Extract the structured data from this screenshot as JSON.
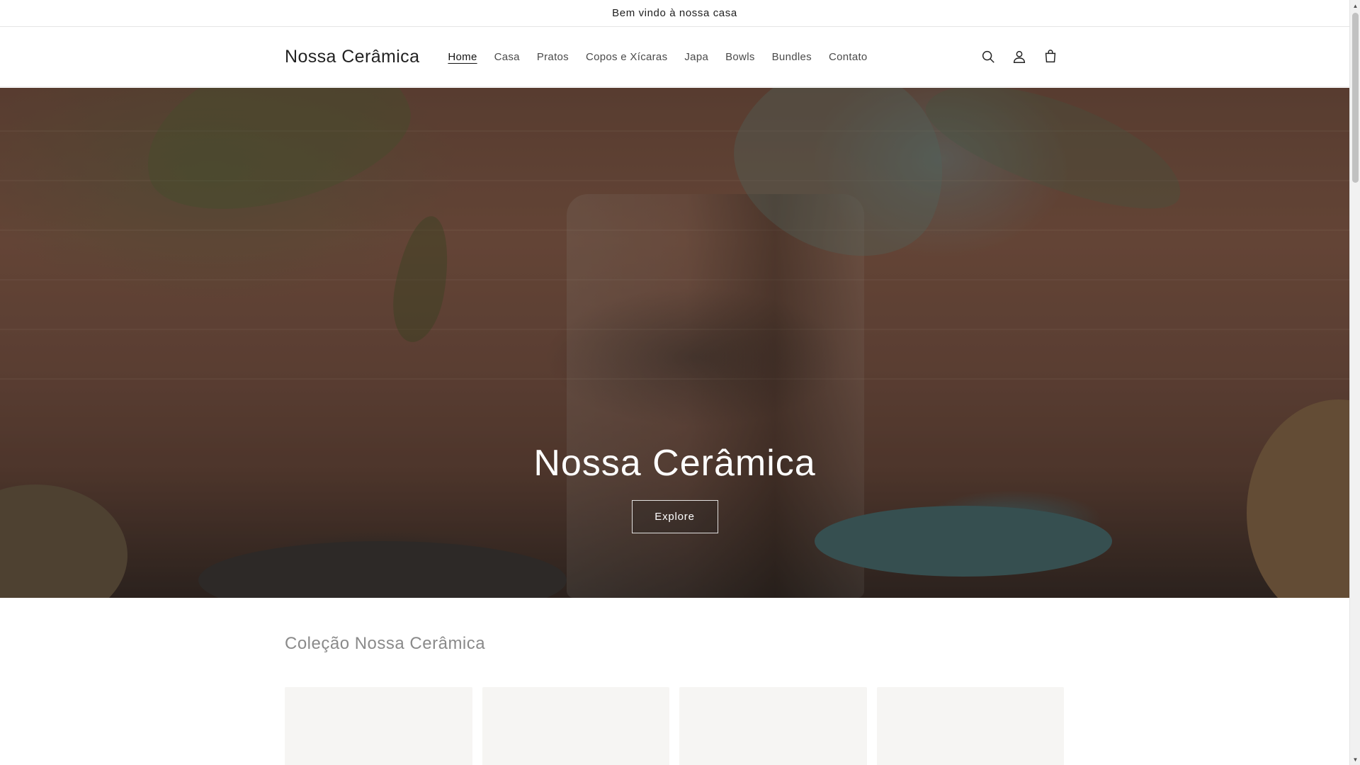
{
  "announcement": {
    "text": "Bem vindo à nossa casa"
  },
  "header": {
    "logo": "Nossa Cerâmica",
    "nav": [
      {
        "label": "Home",
        "active": true
      },
      {
        "label": "Casa"
      },
      {
        "label": "Pratos"
      },
      {
        "label": "Copos e Xícaras"
      },
      {
        "label": "Japa"
      },
      {
        "label": "Bowls"
      },
      {
        "label": "Bundles"
      },
      {
        "label": "Contato"
      }
    ],
    "icons": [
      "search-icon",
      "account-icon",
      "cart-icon"
    ]
  },
  "hero": {
    "title": "Nossa Cerâmica",
    "button_label": "Explore"
  },
  "collection": {
    "title": "Coleção Nossa Cerâmica"
  },
  "colors": {
    "text": "#121212",
    "hero_overlay": "#000000",
    "muted": "#8a8a8a"
  }
}
